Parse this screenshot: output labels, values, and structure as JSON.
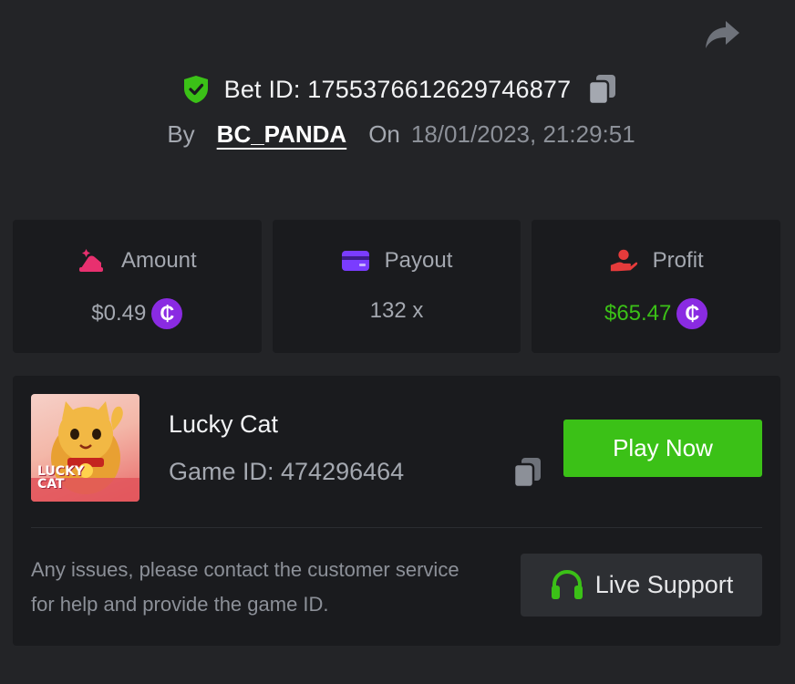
{
  "header": {
    "bet_id_label": "Bet ID: 1755376612629746877",
    "by_label": "By",
    "username": "BC_PANDA",
    "on_label": "On",
    "datetime": "18/01/2023, 21:29:51"
  },
  "stats": {
    "amount": {
      "label": "Amount",
      "value": "$0.49"
    },
    "payout": {
      "label": "Payout",
      "value": "132 x"
    },
    "profit": {
      "label": "Profit",
      "value": "$65.47"
    }
  },
  "game": {
    "title": "Lucky Cat",
    "game_id_label": "Game ID: 474296464",
    "thumbnail_text_line1": "LUCKY",
    "thumbnail_text_line2": "CAT",
    "play_button": "Play Now"
  },
  "support": {
    "message": "Any issues, please contact the customer service for help and provide the game ID.",
    "button_label": "Live Support"
  },
  "icons": {
    "share": "share-arrow-icon",
    "verified": "shield-check-icon",
    "copy": "copy-icon",
    "amount": "bet-amount-icon",
    "payout": "card-icon",
    "profit": "profit-hand-icon",
    "coin": "coin-icon",
    "support": "headset-icon"
  },
  "colors": {
    "background": "#232427",
    "card": "#1a1b1e",
    "accent_green": "#3bc117",
    "coin_purple": "#8a2be2",
    "amount_icon": "#e8306f",
    "payout_icon": "#7a3cff",
    "profit_icon": "#e53b3b"
  }
}
